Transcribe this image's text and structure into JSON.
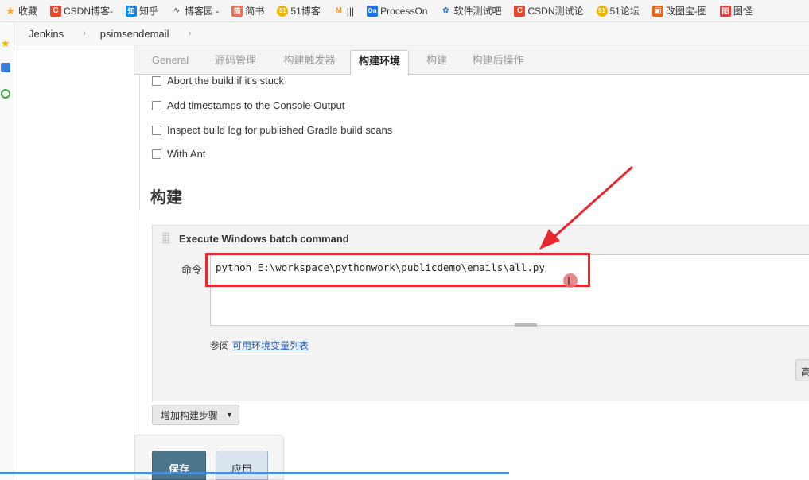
{
  "bookmarks": [
    {
      "label": "收藏",
      "icon": "star-icon",
      "color": "#f5a623",
      "glyph": "★"
    },
    {
      "label": "CSDN博客-",
      "icon": "csdn-icon",
      "color": "#e4472c",
      "glyph": "C"
    },
    {
      "label": "知乎",
      "icon": "zhihu-icon",
      "color": "#0f88eb",
      "glyph": "知"
    },
    {
      "label": "博客园 -",
      "icon": "cnblogs-icon",
      "color": "#555555",
      "glyph": "∿"
    },
    {
      "label": "简书",
      "icon": "jianshu-icon",
      "color": "#ea6f5a",
      "glyph": "简"
    },
    {
      "label": "51博客",
      "icon": "51blog-icon",
      "color": "#f0b400",
      "glyph": "51"
    },
    {
      "label": "|||",
      "icon": "pin-icon",
      "color": "#e6a23c",
      "glyph": "M"
    },
    {
      "label": "ProcessOn",
      "icon": "processon-icon",
      "color": "#1a73e8",
      "glyph": "On"
    },
    {
      "label": "软件测试吧",
      "icon": "paw-icon",
      "color": "#2f6fd6",
      "glyph": "✿"
    },
    {
      "label": "CSDN测试论",
      "icon": "csdn-icon",
      "color": "#e4472c",
      "glyph": "C"
    },
    {
      "label": "51论坛",
      "icon": "51forum-icon",
      "color": "#f0b400",
      "glyph": "51"
    },
    {
      "label": "改图宝-图",
      "icon": "gaitubao-icon",
      "color": "#e8641b",
      "glyph": "▣"
    },
    {
      "label": "图怪",
      "icon": "tuguai-icon",
      "color": "#e23b3b",
      "glyph": "图"
    }
  ],
  "breadcrumb": {
    "items": [
      "Jenkins",
      "psimsendemail"
    ],
    "separator": "›"
  },
  "tabs": [
    {
      "label": "General",
      "active": false
    },
    {
      "label": "源码管理",
      "active": false
    },
    {
      "label": "构建触发器",
      "active": false
    },
    {
      "label": "构建环境",
      "active": true
    },
    {
      "label": "构建",
      "active": false
    },
    {
      "label": "构建后操作",
      "active": false
    }
  ],
  "build_env_options": [
    {
      "label": "Abort the build if it's stuck",
      "checked": false
    },
    {
      "label": "Add timestamps to the Console Output",
      "checked": false
    },
    {
      "label": "Inspect build log for published Gradle build scans",
      "checked": false
    },
    {
      "label": "With Ant",
      "checked": false
    }
  ],
  "build_section": {
    "title": "构建",
    "step_title": "Execute Windows batch command",
    "command_label": "命令",
    "command_value": "python E:\\workspace\\pythonwork\\publicdemo\\emails\\all.py",
    "see_also_prefix": "参阅",
    "see_also_link": "可用环境变量列表",
    "advanced_label": "高",
    "add_step_label": "增加构建步骤"
  },
  "footer": {
    "save_label": "保存",
    "apply_label": "应用"
  },
  "colors": {
    "annotation_red": "#e8282e",
    "save_blue": "#4b758b",
    "link_blue": "#2a5db0"
  }
}
